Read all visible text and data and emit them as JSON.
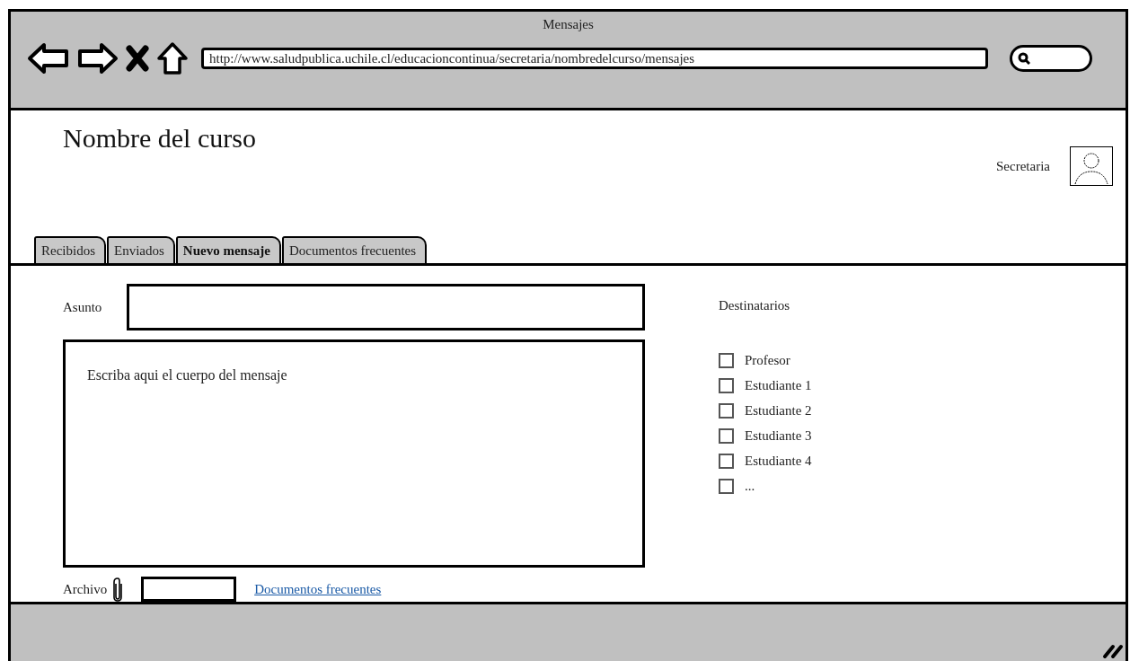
{
  "window": {
    "title": "Mensajes"
  },
  "toolbar": {
    "url": "http://www.saludpublica.uchile.cl/educacioncontinua/secretaria/nombredelcurso/mensajes"
  },
  "header": {
    "course_title": "Nombre del curso",
    "user_name": "Secretaria"
  },
  "tabs": [
    {
      "label": "Recibidos",
      "selected": false
    },
    {
      "label": "Enviados",
      "selected": false
    },
    {
      "label": "Nuevo mensaje",
      "selected": true
    },
    {
      "label": "Documentos frecuentes",
      "selected": false
    }
  ],
  "form": {
    "subject_label": "Asunto",
    "body_placeholder": "Escriba aqui el cuerpo del mensaje",
    "attachment_label": "Archivo",
    "link": "Documentos frecuentes"
  },
  "recipients": {
    "title": "Destinatarios",
    "items": [
      {
        "label": "Profesor",
        "checked": false
      },
      {
        "label": "Estudiante 1",
        "checked": false
      },
      {
        "label": "Estudiante 2",
        "checked": false
      },
      {
        "label": "Estudiante 3",
        "checked": false
      },
      {
        "label": "Estudiante 4",
        "checked": false
      },
      {
        "label": "...",
        "checked": false
      }
    ]
  }
}
